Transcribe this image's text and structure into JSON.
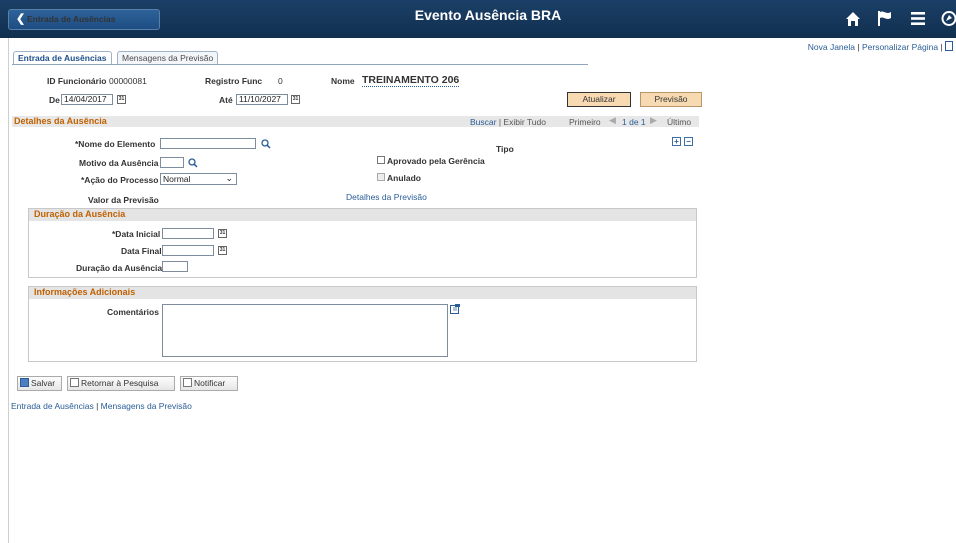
{
  "header": {
    "back_label": "Entrada de Ausências",
    "title": "Evento Ausência BRA",
    "icons": [
      "home-icon",
      "flag-icon",
      "menu-icon",
      "navbar-icon"
    ]
  },
  "toplinks": {
    "new_window": "Nova Janela",
    "personalize": "Personalizar Página"
  },
  "tabs": [
    {
      "label": "Entrada de Ausências",
      "active": true
    },
    {
      "label": "Mensagens da Previsão",
      "active": false
    }
  ],
  "form": {
    "emp_id_label": "ID Funcionário",
    "emp_id_value": "00000081",
    "record_label": "Registro Func",
    "record_value": "0",
    "name_label": "Nome",
    "name_value": "TREINAMENTO 206",
    "from_label": "De",
    "from_value": "14/04/2017",
    "to_label": "Até",
    "to_value": "11/10/2027",
    "refresh_btn": "Atualizar",
    "forecast_btn": "Previsão"
  },
  "details": {
    "title": "Detalhes da Ausência",
    "find": "Buscar",
    "view_all": "Exibir Tudo",
    "first": "Primeiro",
    "pager": "1 de 1",
    "last": "Último",
    "element_label": "*Nome do Elemento",
    "element_value": "",
    "reason_label": "Motivo da Ausência",
    "reason_value": "",
    "action_label": "*Ação do Processo",
    "action_value": "Normal",
    "type_label": "Tipo",
    "approved_label": "Aprovado pela Gerência",
    "voided_label": "Anulado",
    "forecast_value_label": "Valor da Previsão",
    "forecast_details_link": "Detalhes da Previsão"
  },
  "duration": {
    "title": "Duração da Ausência",
    "start_label": "*Data Inicial",
    "start_value": "",
    "end_label": "Data Final",
    "end_value": "",
    "duration_label": "Duração da Ausência",
    "duration_value": ""
  },
  "additional": {
    "title": "Informações Adicionais",
    "comments_label": "Comentários",
    "comments_value": ""
  },
  "toolbar": {
    "save": "Salvar",
    "return": "Retornar à Pesquisa",
    "notify": "Notificar"
  },
  "footer_links": {
    "entry": "Entrada de Ausências",
    "messages": "Mensagens da Previsão"
  }
}
